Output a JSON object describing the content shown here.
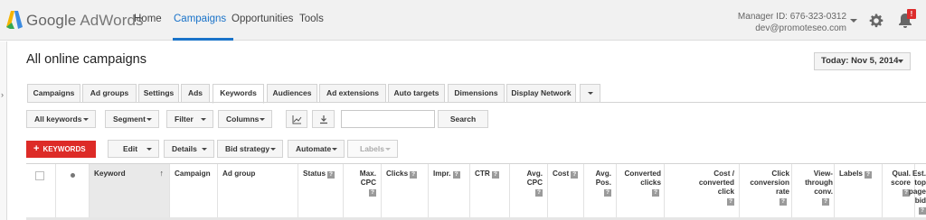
{
  "brand": {
    "google": "Google",
    "product": "AdWords"
  },
  "nav": [
    {
      "label": "Home"
    },
    {
      "label": "Campaigns"
    },
    {
      "label": "Opportunities"
    },
    {
      "label": "Tools"
    }
  ],
  "account": {
    "manager_id": "Manager ID: 676-323-0312",
    "email": "dev@promoteseo.com"
  },
  "notifications": {
    "badge": "!"
  },
  "page": {
    "title": "All online campaigns",
    "date_range": "Today: Nov 5, 2014"
  },
  "tabs": [
    {
      "label": "Campaigns"
    },
    {
      "label": "Ad groups"
    },
    {
      "label": "Settings"
    },
    {
      "label": "Ads"
    },
    {
      "label": "Keywords"
    },
    {
      "label": "Audiences"
    },
    {
      "label": "Ad extensions"
    },
    {
      "label": "Auto targets"
    },
    {
      "label": "Dimensions"
    },
    {
      "label": "Display Network"
    }
  ],
  "active_tab": "Keywords",
  "filters": {
    "all_keywords": "All keywords",
    "segment": "Segment",
    "filter": "Filter",
    "columns": "Columns",
    "search_value": "",
    "search_label": "Search"
  },
  "actions": {
    "add_keywords": "KEYWORDS",
    "edit": "Edit",
    "details": "Details",
    "bid_strategy": "Bid strategy",
    "automate": "Automate",
    "labels": "Labels"
  },
  "table": {
    "help_glyph": "?",
    "columns": [
      {
        "label": "Keyword",
        "help": false
      },
      {
        "label": "Campaign",
        "help": false
      },
      {
        "label": "Ad group",
        "help": false
      },
      {
        "label": "Status",
        "help": true
      },
      {
        "label": "Max. CPC",
        "help": true
      },
      {
        "label": "Clicks",
        "help": true
      },
      {
        "label": "Impr.",
        "help": true
      },
      {
        "label": "CTR",
        "help": true
      },
      {
        "label": "Avg. CPC",
        "help": true
      },
      {
        "label": "Cost",
        "help": true
      },
      {
        "label": "Avg. Pos.",
        "help": true
      },
      {
        "label": "Converted clicks",
        "help": true
      },
      {
        "label": "Cost / converted click",
        "help": true
      },
      {
        "label": "Click conversion rate",
        "help": true
      },
      {
        "label": "View-through conv.",
        "help": true
      },
      {
        "label": "Labels",
        "help": true
      },
      {
        "label": "Qual. score",
        "help": true
      },
      {
        "label": "Est. top page bid",
        "help": true
      }
    ]
  },
  "colors": {
    "accent": "#1a73c9",
    "primary_button": "#dd2b27",
    "badge": "#dd2c2c"
  }
}
